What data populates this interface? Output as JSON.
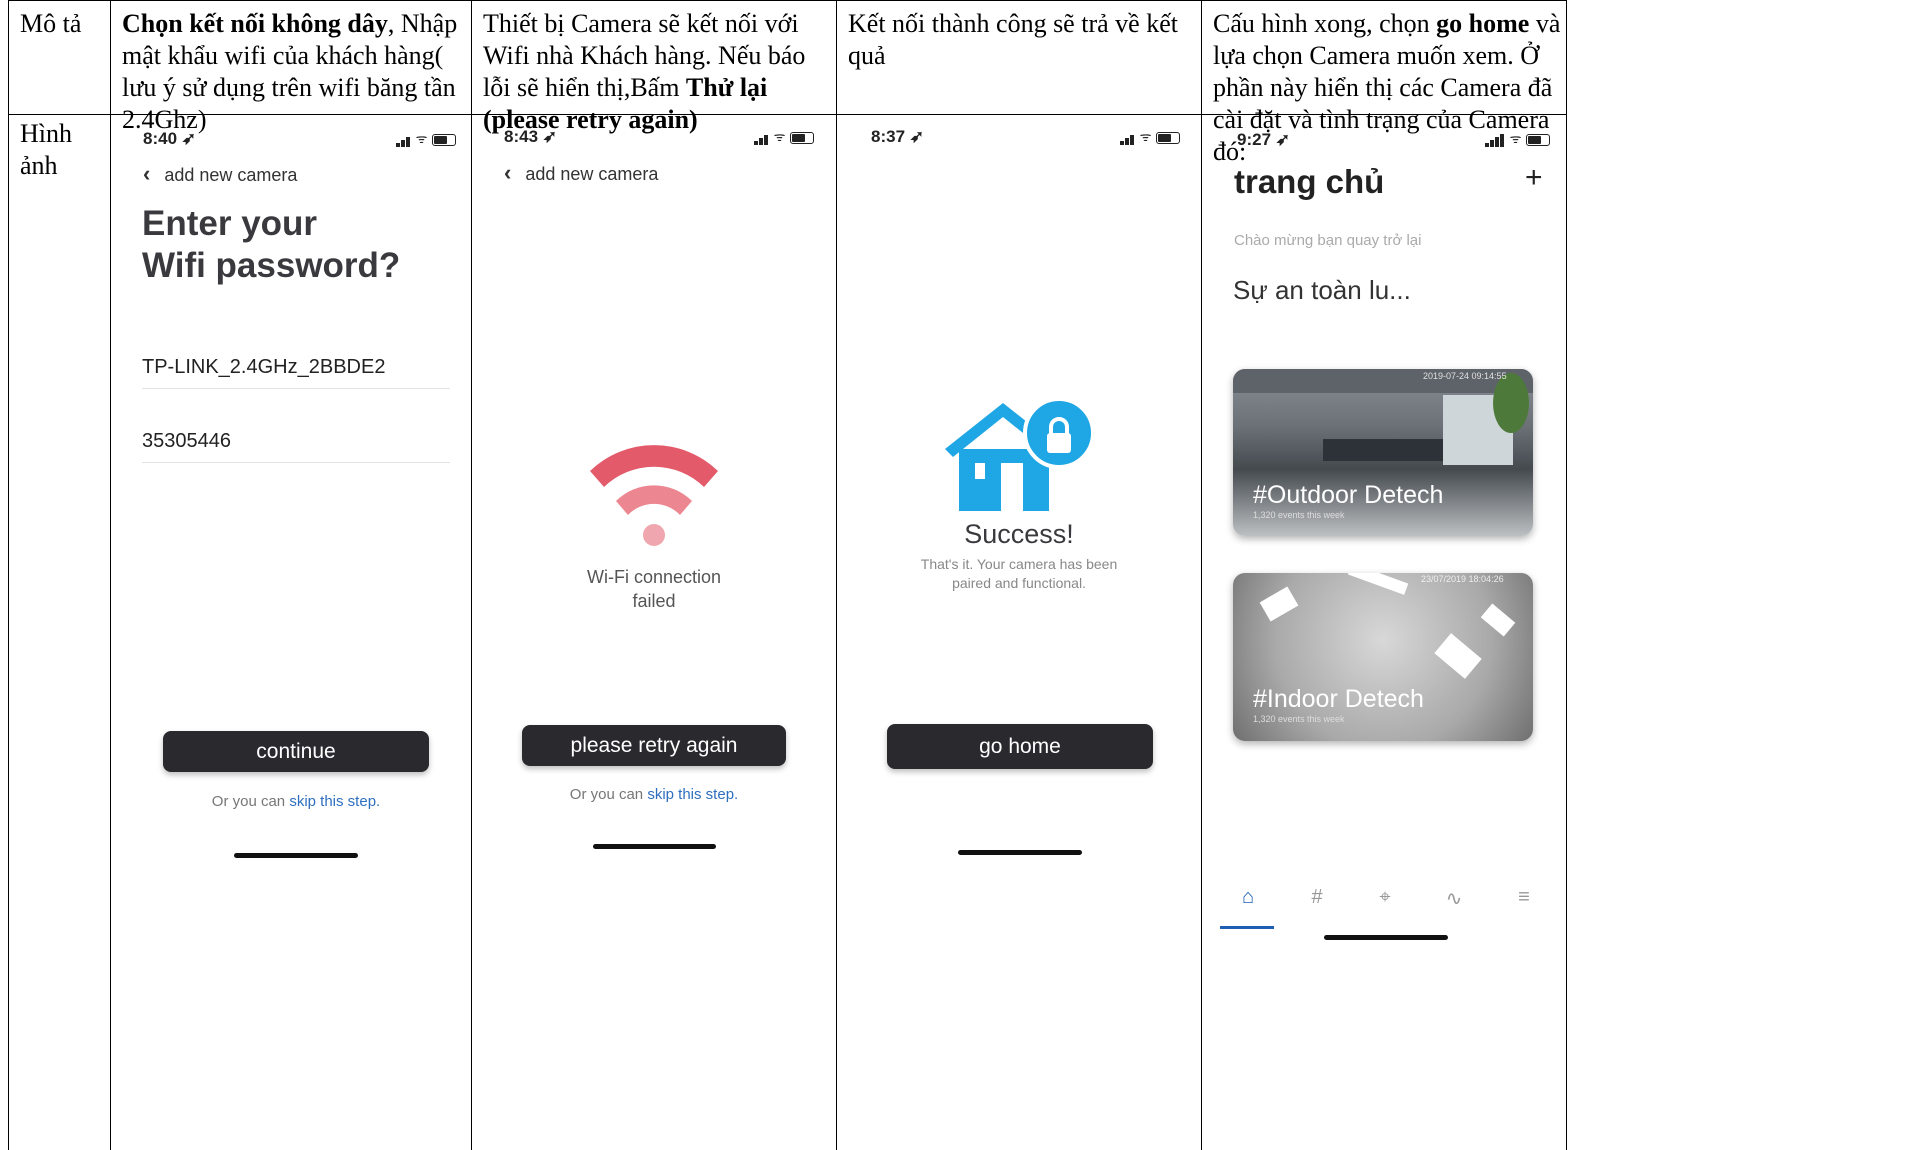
{
  "table": {
    "row1_header": "Mô tả",
    "row2_header": "Hình ảnh",
    "col1": {
      "bold": "Chọn kết nối không dây",
      "rest": ", Nhập mật khẩu wifi của khách hàng( lưu ý sử dụng trên wifi băng tần 2.4Ghz)"
    },
    "col2": {
      "pre": "Thiết bị Camera sẽ kết nối với Wifi nhà Khách hàng. Nếu báo lỗi sẽ hiển thị,Bấm ",
      "bold": "Thử lại (please retry again)"
    },
    "col3": {
      "text": "Kết nối thành công sẽ trả về kết quả"
    },
    "col4": {
      "pre": "Cấu hình xong, chọn ",
      "bold": "go home",
      "rest": " và lựa chọn Camera muốn xem. Ở phần này hiển thị các Camera đã cài đặt và tình trạng của Camera đó:"
    }
  },
  "screen1": {
    "time": "8:40",
    "back_label": "add new camera",
    "title_line1": "Enter your",
    "title_line2": "Wifi password?",
    "ssid": "TP-LINK_2.4GHz_2BBDE2",
    "password": "35305446",
    "button": "continue",
    "skip_prefix": "Or you can ",
    "skip_link": "skip this step."
  },
  "screen2": {
    "time": "8:43",
    "back_label": "add new camera",
    "error_line1": "Wi-Fi connection",
    "error_line2": "failed",
    "button": "please retry again",
    "skip_prefix": "Or you can ",
    "skip_link": "skip this step.",
    "wifi_color": "#e35b6a"
  },
  "screen3": {
    "time": "8:37",
    "success_title": "Success!",
    "success_line1": "That's it. Your camera has been",
    "success_line2": "paired and functional.",
    "button": "go home",
    "house_color": "#1ea7e4"
  },
  "screen4": {
    "time": "9:27",
    "title": "trang chủ",
    "add_symbol": "+",
    "welcome": "Chào mừng bạn quay trở lại",
    "headline": "Sự an toàn lu...",
    "cameras": [
      {
        "label": "#Outdoor Detech",
        "sub": "1,320 events this week",
        "timestamp": "2019-07-24 09:14:55"
      },
      {
        "label": "#Indoor Detech",
        "sub": "1,320 events this week",
        "timestamp": "23/07/2019 18:04:26"
      }
    ],
    "tab_icons": [
      "home-icon",
      "hash-icon",
      "target-icon",
      "activity-icon",
      "menu-icon"
    ],
    "accent": "#1e5fb3"
  }
}
